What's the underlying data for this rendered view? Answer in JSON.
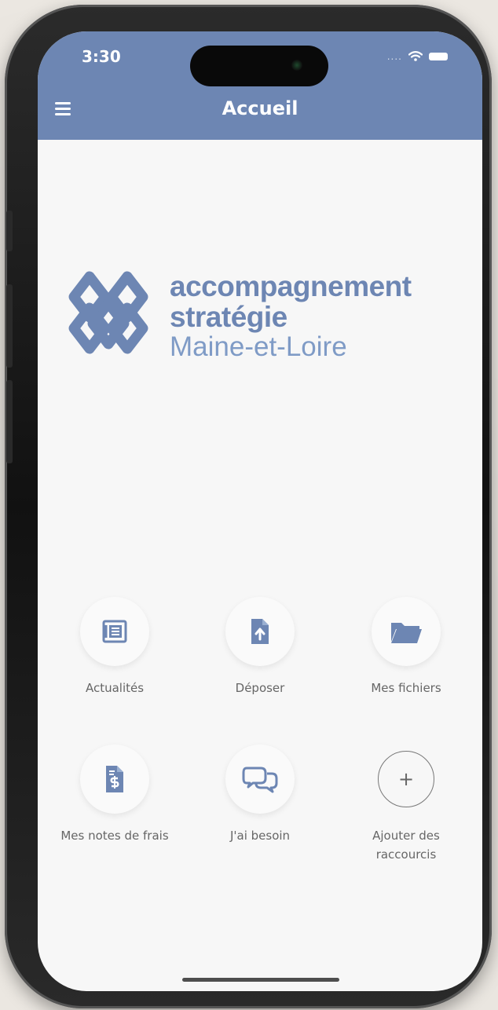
{
  "status": {
    "time": "3:30",
    "signal": "....",
    "wifi_icon": "wifi-icon",
    "battery_icon": "battery-icon"
  },
  "header": {
    "title": "Accueil",
    "menu_icon": "menu-icon",
    "background_color": "#6d86b3"
  },
  "logo": {
    "line1": "accompagnement",
    "line2": "stratégie",
    "line3": "Maine-et-Loire",
    "color": "#6d86b3"
  },
  "shortcuts": [
    {
      "label": "Actualités",
      "icon": "newspaper-icon"
    },
    {
      "label": "Déposer",
      "icon": "upload-document-icon"
    },
    {
      "label": "Mes fichiers",
      "icon": "folder-icon"
    },
    {
      "label": "Mes notes de frais",
      "icon": "expense-note-icon"
    },
    {
      "label": "J'ai besoin",
      "icon": "chat-bubbles-icon"
    },
    {
      "label": "Ajouter des raccourcis",
      "icon": "plus-icon"
    }
  ],
  "theme": {
    "accent": "#6d86b3",
    "background": "#f7f7f7",
    "text": "#666666"
  }
}
